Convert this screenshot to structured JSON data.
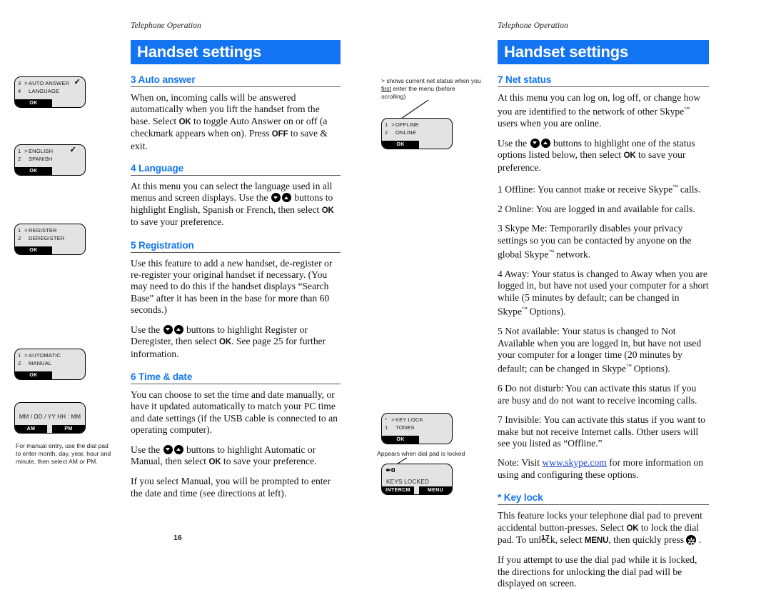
{
  "left_page": {
    "running_head": "Telephone Operation",
    "banner_title": "Handset settings",
    "page_number": "16",
    "sections": [
      {
        "heading": "3 Auto answer",
        "paragraphs": [
          "When on, incoming calls will be answered automatically when you lift the handset from the base. Select OK to toggle Auto Answer on or off (a checkmark appears when on). Press OFF to save & exit."
        ]
      },
      {
        "heading": "4 Language",
        "paragraphs": [
          "At this menu you can select the language used in all menus and screen displays. Use the ▼▲ buttons to highlight English, Spanish or French, then select OK to save your preference."
        ]
      },
      {
        "heading": "5 Registration",
        "paragraphs": [
          "Use this feature to add a new handset, de-register or re-register your original handset if necessary. (You may need to do this if the handset displays “Search Base” after it has been in the base for more than 60 seconds.)",
          "Use the ▼▲ buttons to highlight Register or Deregister, then select OK. See page 25 for further information."
        ]
      },
      {
        "heading": "6 Time & date",
        "paragraphs": [
          "You can choose to set the time and date manually, or have it updated automatically to match your PC time and date settings (if the USB cable is connected to an operating computer).",
          "Use the ▼▲ buttons to highlight Automatic or Manual, then select OK to save your preference.",
          "If you select Manual, you will be prompted to enter the date and time (see directions at left)."
        ]
      }
    ]
  },
  "right_page": {
    "running_head": "Telephone Operation",
    "banner_title": "Handset settings",
    "page_number": "17",
    "sections": [
      {
        "heading": "7 Net status",
        "paragraphs": [
          "At this menu you can log on, log off, or change how you are identified to the network of other Skype™ users when you are online.",
          "Use the ▼▲ buttons to highlight one of the status options listed below, then select OK to save your preference.",
          "1 Offline: You cannot make or receive Skype™ calls.",
          "2 Online: You are logged in and available for calls.",
          "3 Skype Me: Temporarily disables your privacy settings so you can be contacted by anyone on the global Skype™ network.",
          "4 Away: Your status is changed to Away when you are logged in, but have not used your computer for a short while (5 minutes by default; can be changed in Skype™ Options).",
          "5 Not available: Your status is changed to Not Available when you are logged in, but have not used your computer for a longer time (20 minutes by default; can be changed in Skype™ Options).",
          "6 Do not disturb: You can activate this status if you are busy and do not want to receive incoming calls.",
          "7 Invisible: You can activate this status if you want to make but not receive Internet calls. Other users will see you listed as “Offline.”",
          "Note: Visit www.skype.com for more information on using and configuring these options."
        ],
        "note_link_text": "www.skype.com"
      },
      {
        "heading": "* Key lock",
        "paragraphs": [
          "This feature locks your telephone dial pad to prevent accidental button-presses. Select OK to lock the dial pad. To unlock, select MENU, then quickly press ✱.",
          "If you attempt to use the dial pad while it is locked, the directions for unlocking the dial pad will be displayed on screen."
        ]
      }
    ]
  },
  "lcd_screens": [
    {
      "id": "auto-answer",
      "rows": [
        {
          "num": "3",
          "caret": ">",
          "label": "AUTO ANSWER",
          "check": true
        },
        {
          "num": "4",
          "caret": "",
          "label": "LANGUAGE",
          "check": false
        }
      ],
      "softkeys": [
        "OK"
      ]
    },
    {
      "id": "language",
      "rows": [
        {
          "num": "1",
          "caret": ">",
          "label": "ENGLISH",
          "check": true
        },
        {
          "num": "2",
          "caret": "",
          "label": "SPANISH",
          "check": false
        }
      ],
      "softkeys": [
        "OK"
      ]
    },
    {
      "id": "registration",
      "rows": [
        {
          "num": "1",
          "caret": ">",
          "label": "REGISTER",
          "check": false
        },
        {
          "num": "2",
          "caret": "",
          "label": "DEREGISTER",
          "check": false
        }
      ],
      "softkeys": [
        "OK"
      ]
    },
    {
      "id": "time-date-mode",
      "rows": [
        {
          "num": "1",
          "caret": ">",
          "label": "AUTOMATIC",
          "check": false
        },
        {
          "num": "2",
          "caret": "",
          "label": "MANUAL",
          "check": false
        }
      ],
      "softkeys": [
        "OK"
      ]
    },
    {
      "id": "date-entry",
      "datetime": "MM / DD / YY   HH : MM",
      "softkeys": [
        "AM",
        "PM"
      ]
    },
    {
      "id": "net-status",
      "rows": [
        {
          "num": "1",
          "caret": ">",
          "label": "OFFLINE",
          "check": false
        },
        {
          "num": "2",
          "caret": "",
          "label": "ONLINE",
          "check": false
        }
      ],
      "softkeys": [
        "OK"
      ]
    },
    {
      "id": "key-lock",
      "rows": [
        {
          "num": "*",
          "caret": ">",
          "label": "KEY LOCK",
          "check": false
        },
        {
          "num": "1",
          "caret": "",
          "label": "TONES",
          "check": false
        }
      ],
      "softkeys": [
        "OK"
      ]
    },
    {
      "id": "keys-locked",
      "center_line": "KEYS LOCKED",
      "softkeys": [
        "INTERCM",
        "MENU"
      ]
    }
  ],
  "notes": {
    "manual_entry": "For manual entry, use the dial pad to enter month, day, year, hour and minute, then select AM or PM.",
    "net_status_caret": "> shows current net status when you first enter the menu (before scrolling)",
    "keys_locked": "Appears when dial pad is locked"
  },
  "colors": {
    "banner_blue": "#1274f0",
    "heading_blue": "#1274f0",
    "link_blue": "#1a3fd0",
    "lcd_background": "#e3e3e3",
    "softkey_background": "#000000"
  }
}
